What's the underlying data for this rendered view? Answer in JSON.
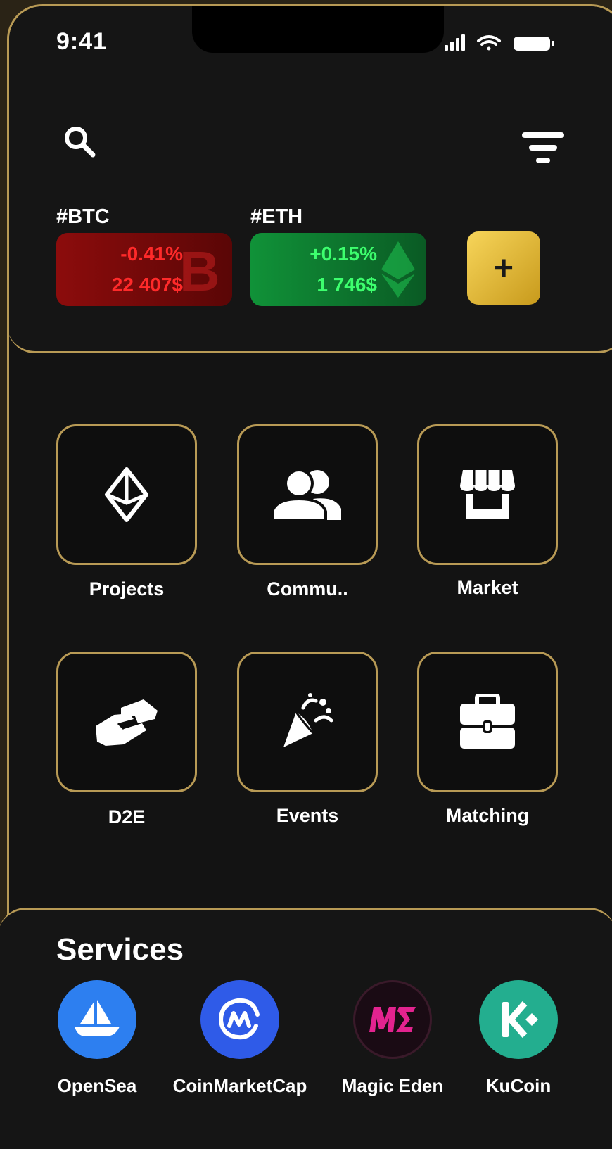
{
  "status": {
    "time": "9:41"
  },
  "header": {
    "search_icon": "search-icon",
    "filter_icon": "filter-icon"
  },
  "tickers": [
    {
      "tag": "#BTC",
      "change": "-0.41%",
      "price": "22 407$",
      "color": "#ff2a2a"
    },
    {
      "tag": "#ETH",
      "change": "+0.15%",
      "price": "1 746$",
      "color": "#3dff6e"
    }
  ],
  "add_button": {
    "label": "+"
  },
  "menu": [
    {
      "label": "Projects",
      "icon": "ethereum-icon"
    },
    {
      "label": "Commu..",
      "icon": "users-icon"
    },
    {
      "label": "Market",
      "icon": "store-icon"
    },
    {
      "label": "D2E",
      "icon": "handshake-icon"
    },
    {
      "label": "Events",
      "icon": "party-popper-icon"
    },
    {
      "label": "Matching",
      "icon": "briefcase-icon"
    }
  ],
  "services": {
    "title": "Services",
    "items": [
      {
        "label": "OpenSea",
        "icon": "opensea-icon",
        "color": "#2d7ff0"
      },
      {
        "label": "CoinMarketCap",
        "icon": "coinmarketcap-icon",
        "color": "#2f5be8"
      },
      {
        "label": "Magic Eden",
        "icon": "magic-eden-icon",
        "color": "#1a0b14"
      },
      {
        "label": "KuCoin",
        "icon": "kucoin-icon",
        "color": "#23ae8f"
      }
    ]
  },
  "colors": {
    "accent_gold": "#b89a55",
    "background": "#131313"
  }
}
